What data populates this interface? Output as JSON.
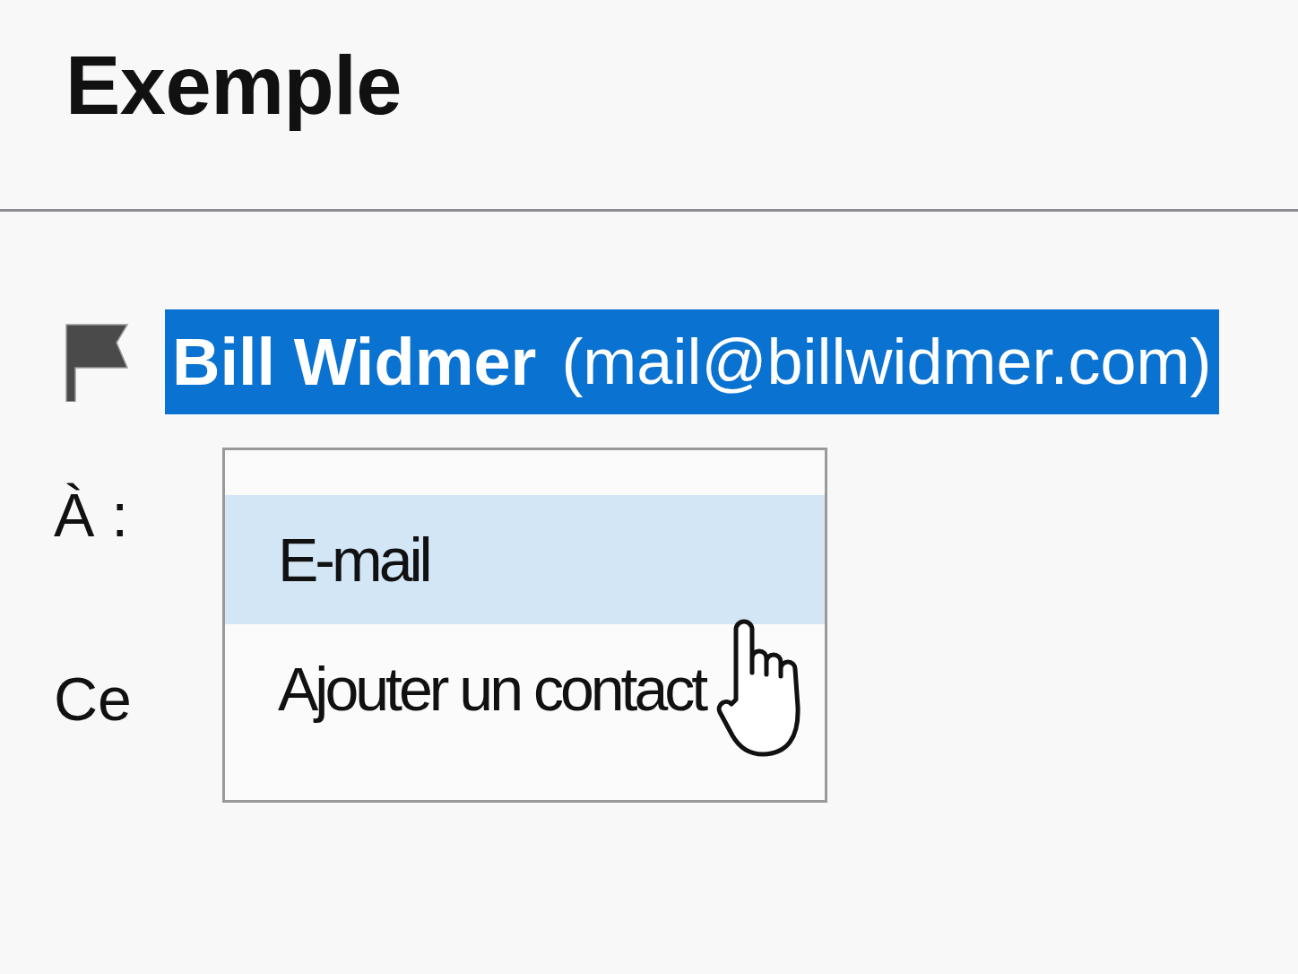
{
  "title": "Exemple",
  "sender": {
    "name": "Bill Widmer",
    "email": "(mail@billwidmer.com)",
    "selected": true
  },
  "fields": [
    {
      "label": "À :"
    },
    {
      "label": "Ce"
    }
  ],
  "menu": {
    "items": [
      {
        "label": "E-mail",
        "selected": true
      },
      {
        "label": "Ajouter un contact",
        "selected": false
      }
    ]
  }
}
